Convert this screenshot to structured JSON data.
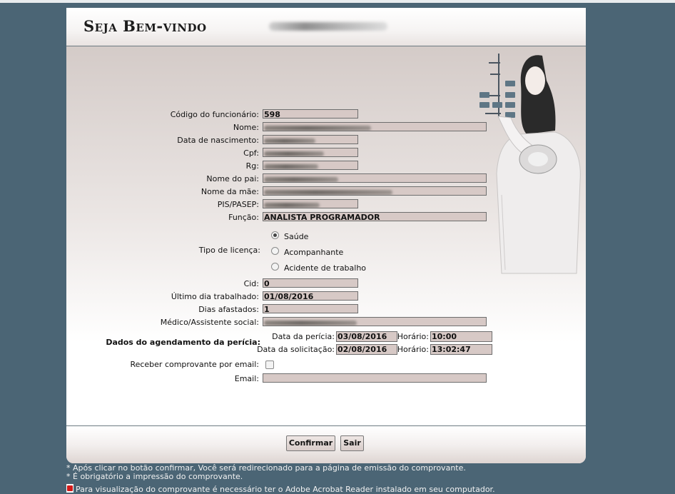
{
  "header": {
    "title": "Seja Bem-vindo"
  },
  "form": {
    "codigo_label": "Código do funcionário:",
    "codigo_value": "598",
    "nome_label": "Nome:",
    "nascimento_label": "Data de nascimento:",
    "cpf_label": "Cpf:",
    "rg_label": "Rg:",
    "pai_label": "Nome do pai:",
    "mae_label": "Nome da mãe:",
    "pis_label": "PIS/PASEP:",
    "funcao_label": "Função:",
    "funcao_value": "ANALISTA PROGRAMADOR",
    "licenca_label": "Tipo de licença:",
    "licenca_options": [
      "Saúde",
      "Acompanhante",
      "Acidente de trabalho"
    ],
    "licenca_selected": "Saúde",
    "cid_label": "Cid:",
    "cid_value": "0",
    "ultimo_dia_label": "Último dia trabalhado:",
    "ultimo_dia_value": "01/08/2016",
    "dias_label": "Dias afastados:",
    "dias_value": "1",
    "medico_label": "Médico/Assistente social:",
    "agendamento_label": "Dados do agendamento da perícia:",
    "data_pericia_label": "Data da perícia:",
    "data_pericia_value": "03/08/2016",
    "horario1_label": "Horário:",
    "horario1_value": "10:00",
    "data_solicitacao_label": "Data da solicitação:",
    "data_solicitacao_value": "02/08/2016",
    "horario2_label": "Horário:",
    "horario2_value": "13:02:47",
    "comprovante_label": "Receber comprovante por email:",
    "email_label": "Email:",
    "email_value": ""
  },
  "buttons": {
    "confirmar": "Confirmar",
    "sair": "Sair"
  },
  "notes": [
    "* Após clicar no botão confirmar, Você será redirecionado para a página de emissão do comprovante.",
    "* É obrigatório a impressão do comprovante.",
    "Para visualização do comprovante é necessário ter o Adobe Acrobat Reader instalado em seu computador."
  ],
  "colors": {
    "background": "#4b6575",
    "field": "#d7c9c6"
  }
}
